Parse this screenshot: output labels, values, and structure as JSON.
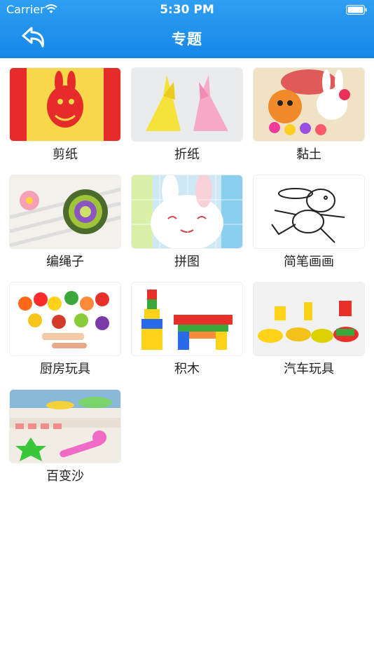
{
  "status_bar": {
    "carrier": "Carrier",
    "time": "5:30 PM"
  },
  "nav": {
    "title": "专题",
    "back_icon": "back-arrow-icon"
  },
  "colors": {
    "nav_bg": "#1a8ee9",
    "nav_text": "#ffffff",
    "label_text": "#222222"
  },
  "topics": [
    {
      "label": "剪纸"
    },
    {
      "label": "折纸"
    },
    {
      "label": "黏土"
    },
    {
      "label": "编绳子"
    },
    {
      "label": "拼图"
    },
    {
      "label": "简笔画画"
    },
    {
      "label": "厨房玩具"
    },
    {
      "label": "积木"
    },
    {
      "label": "汽车玩具"
    },
    {
      "label": "百变沙"
    }
  ]
}
